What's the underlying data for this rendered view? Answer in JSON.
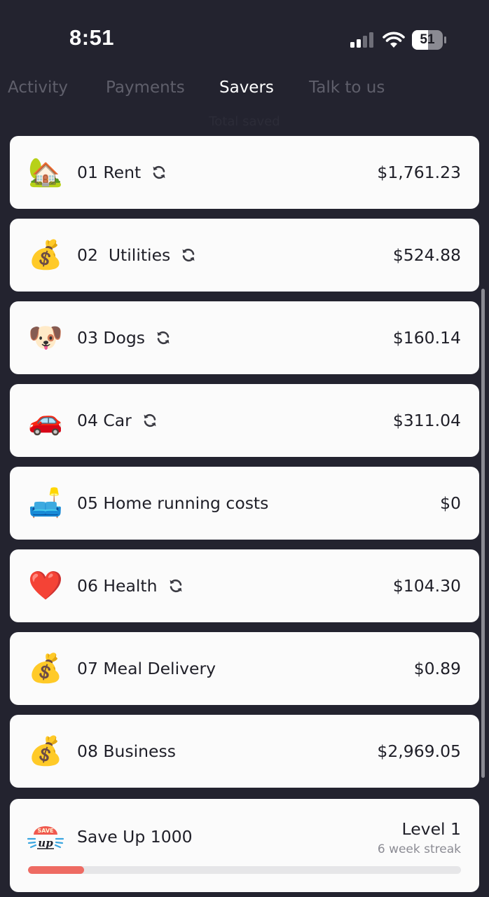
{
  "status_bar": {
    "time": "8:51",
    "battery": "51"
  },
  "tabs": [
    {
      "label": "Activity"
    },
    {
      "label": "Payments"
    },
    {
      "label": "Savers"
    },
    {
      "label": "Talk to us"
    }
  ],
  "total_saved_label": "Total saved",
  "savers": [
    {
      "name": "01 Rent",
      "amount": "$1,761.23",
      "emoji": "🏡",
      "icon": "house-with-garden-icon",
      "recurring": true
    },
    {
      "name": "02  Utilities",
      "amount": "$524.88",
      "emoji": "💰",
      "icon": "money-bag-icon",
      "recurring": true
    },
    {
      "name": "03 Dogs",
      "amount": "$160.14",
      "emoji": "🐶",
      "icon": "dog-face-icon",
      "recurring": true
    },
    {
      "name": "04 Car",
      "amount": "$311.04",
      "emoji": "🚗",
      "icon": "car-icon",
      "recurring": true
    },
    {
      "name": "05 Home running costs",
      "amount": "$0",
      "emoji": "🛋️",
      "icon": "couch-and-lamp-icon",
      "recurring": false
    },
    {
      "name": "06 Health",
      "amount": "$104.30",
      "emoji": "❤️",
      "icon": "red-heart-icon",
      "recurring": true
    },
    {
      "name": "07 Meal Delivery",
      "amount": "$0.89",
      "emoji": "💰",
      "icon": "money-bag-icon",
      "recurring": false
    },
    {
      "name": "08 Business",
      "amount": "$2,969.05",
      "emoji": "💰",
      "icon": "money-bag-icon",
      "recurring": false
    }
  ],
  "goal": {
    "name": "Save Up 1000",
    "level": "Level 1",
    "streak": "6 week streak",
    "progress": 0.13,
    "logo_text_top": "SAVE",
    "logo_text_bottom": "up",
    "icon": "save-up-logo"
  },
  "colors": {
    "background": "#23232f",
    "card": "#fbfbfb",
    "progress": "#ee6b63",
    "tab_inactive": "#5f5f6b"
  }
}
